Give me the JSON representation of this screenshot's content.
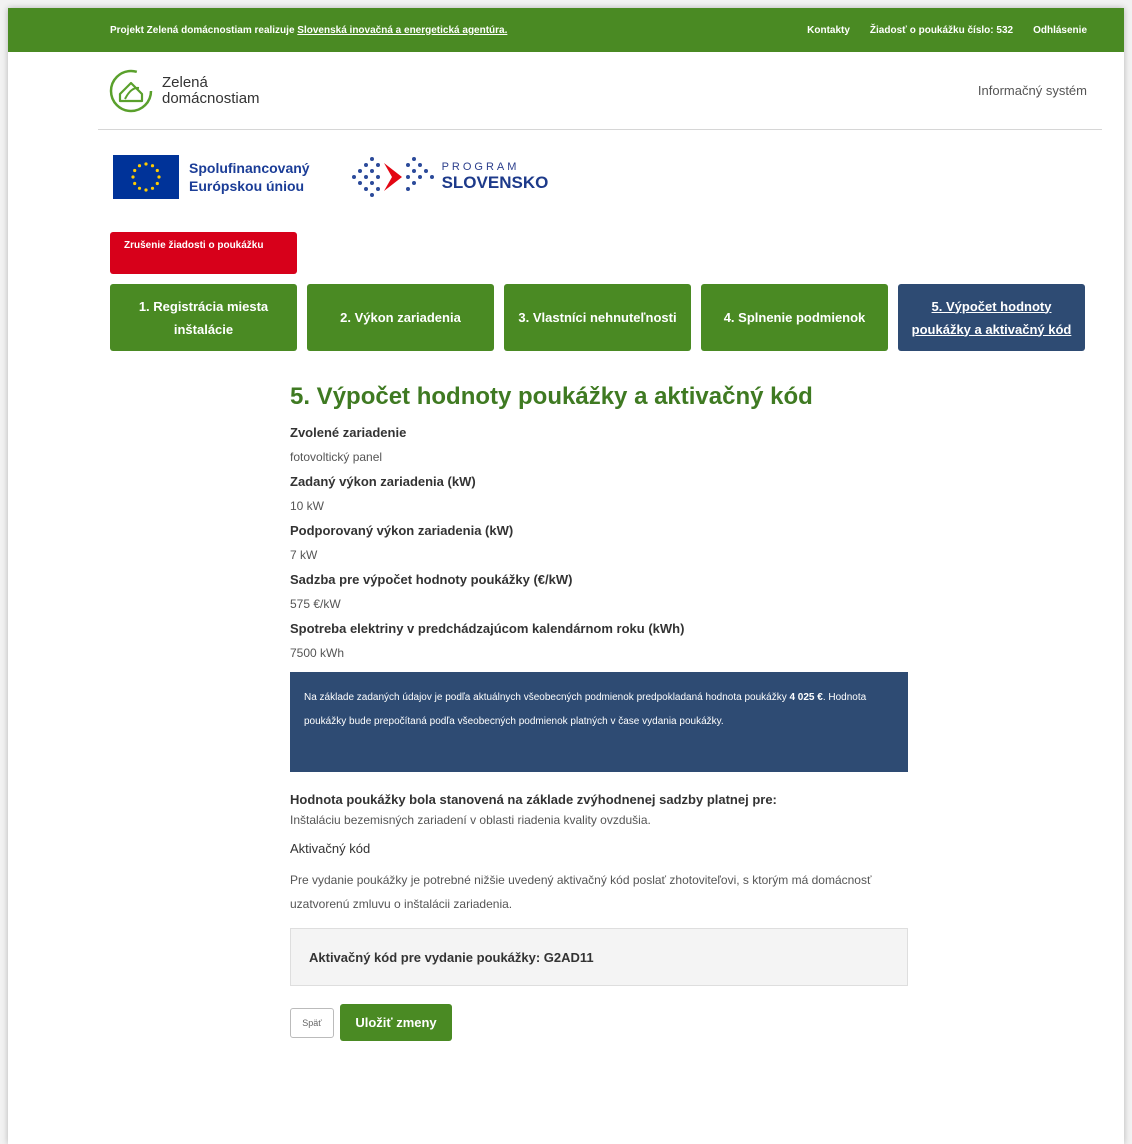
{
  "topbar": {
    "project_text": "Projekt Zelená domácnostiam realizuje ",
    "agency_link": "Slovenská inovačná a energetická agentúra.",
    "contacts": "Kontakty",
    "request": "Žiadosť o poukážku číslo: 532",
    "logout": "Odhlásenie"
  },
  "header": {
    "logo_line1": "Zelená",
    "logo_line2": "domácnostiam",
    "info_system": "Informačný systém"
  },
  "partners": {
    "eu_line1": "Spolufinancovaný",
    "eu_line2": "Európskou úniou",
    "program_line1": "PROGRAM",
    "program_line2": "SLOVENSKO"
  },
  "cancel_label": "Zrušenie žiadosti o poukážku",
  "steps": [
    {
      "label": "1. Registrácia miesta inštalácie"
    },
    {
      "label": "2. Výkon zariadenia"
    },
    {
      "label": "3. Vlastníci nehnuteľnosti"
    },
    {
      "label": "4. Splnenie podmienok"
    },
    {
      "label": "5. Výpočet hodnoty poukážky a aktivačný kód"
    }
  ],
  "main": {
    "title": "5. Výpočet hodnoty poukážky a aktivačný kód",
    "fields": [
      {
        "label": "Zvolené zariadenie",
        "value": "fotovoltický panel"
      },
      {
        "label": "Zadaný výkon zariadenia (kW)",
        "value": "10 kW"
      },
      {
        "label": "Podporovaný výkon zariadenia (kW)",
        "value": "7 kW"
      },
      {
        "label": "Sadzba pre výpočet hodnoty poukážky (€/kW)",
        "value": "575 €/kW"
      },
      {
        "label": "Spotreba elektriny v predchádzajúcom kalendárnom roku (kWh)",
        "value": "7500 kWh"
      }
    ],
    "notice_pre": "Na základe zadaných údajov je podľa aktuálnych všeobecných podmienok predpokladaná hodnota poukážky ",
    "notice_amount": "4 025 €",
    "notice_post": ". Hodnota poukážky bude prepočítaná podľa všeobecných podmienok platných v čase vydania poukážky.",
    "basis_label": "Hodnota poukážky bola stanovená na základe zvýhodnenej sadzby platnej pre:",
    "basis_value": "Inštaláciu bezemisných zariadení v oblasti riadenia kvality ovzdušia.",
    "code_label": "Aktivačný kód",
    "code_desc": "Pre vydanie poukážky je potrebné nižšie uvedený aktivačný kód poslať zhotoviteľovi, s ktorým má domácnosť uzatvorenú zmluvu o inštalácii zariadenia.",
    "code_box": "Aktivačný kód pre vydanie poukážky: G2AD11",
    "back_label": "Späť",
    "save_label": "Uložiť zmeny"
  },
  "colors": {
    "green": "#4a8a23",
    "dark_blue": "#2e4b73",
    "red": "#d7001a",
    "title_green": "#3f7a22"
  }
}
